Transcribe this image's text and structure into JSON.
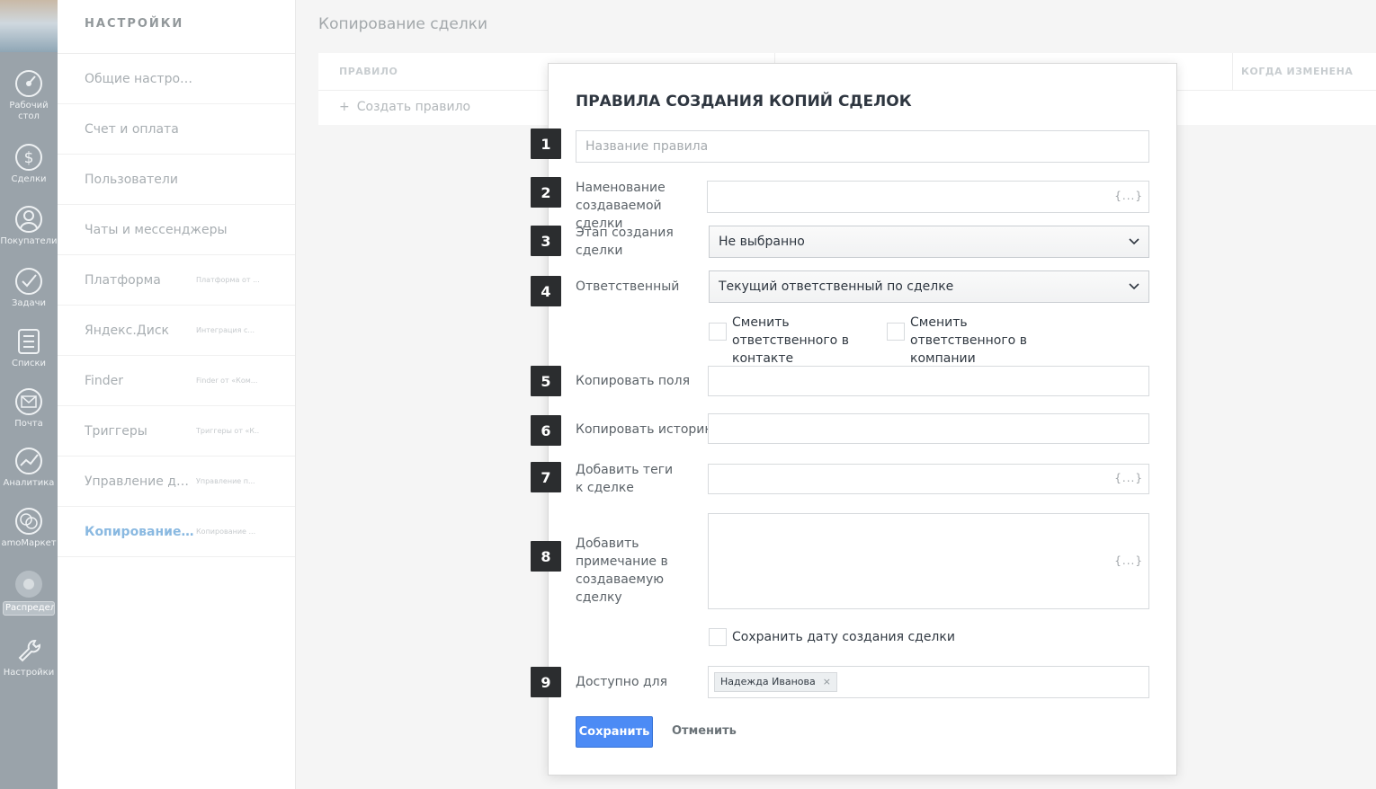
{
  "sidebar": {
    "items": [
      {
        "label": "Рабочий стол",
        "icon": "dashboard-icon"
      },
      {
        "label": "Сделки",
        "icon": "dollar-icon"
      },
      {
        "label": "Покупатели",
        "icon": "customers-icon"
      },
      {
        "label": "Задачи",
        "icon": "check-icon"
      },
      {
        "label": "Списки",
        "icon": "list-icon"
      },
      {
        "label": "Почта",
        "icon": "mail-icon"
      },
      {
        "label": "Аналитика",
        "icon": "analytics-icon"
      },
      {
        "label": "amoМаркет",
        "icon": "market-icon"
      },
      {
        "label": "Распредел",
        "icon": "distribution-icon"
      },
      {
        "label": "Настройки",
        "icon": "wrench-icon"
      }
    ]
  },
  "settings": {
    "title": "НАСТРОЙКИ",
    "items": [
      {
        "label": "Общие настройки",
        "sub": ""
      },
      {
        "label": "Счет и оплата",
        "sub": ""
      },
      {
        "label": "Пользователи",
        "sub": ""
      },
      {
        "label": "Чаты и мессенджеры",
        "sub": ""
      },
      {
        "label": "Платформа",
        "sub": "Платформа от ..."
      },
      {
        "label": "Яндекс.Диск",
        "sub": "Интеграция с..."
      },
      {
        "label": "Finder",
        "sub": "Finder от «Ком..."
      },
      {
        "label": "Триггеры",
        "sub": "Триггеры от «К..."
      },
      {
        "label": "Управление дан...",
        "sub": "Управление п..."
      },
      {
        "label": "Копирование сд...",
        "sub": "Копирование ..."
      }
    ]
  },
  "main": {
    "title": "Копирование сделки",
    "columns": {
      "rule": "ПРАВИЛО",
      "changed": "КОГДА ИЗМЕНЕНА"
    },
    "create_rule": "Создать правило"
  },
  "modal": {
    "title": "ПРАВИЛА СОЗДАНИЯ КОПИЙ СДЕЛОК",
    "badges": [
      "1",
      "2",
      "3",
      "4",
      "5",
      "6",
      "7",
      "8",
      "9"
    ],
    "rule_name_placeholder": "Название правила",
    "deal_name_label": "Наменование создаваемой сделки",
    "braces": "{...}",
    "stage_label": "Этап создания сделки",
    "stage_value": "Не выбранно",
    "responsible_label": "Ответственный",
    "responsible_value": "Текущий ответственный по сделке",
    "change_contact": "Сменить ответственного в контакте",
    "change_company": "Сменить ответственного в компании",
    "copy_fields_label": "Копировать поля",
    "copy_history_label": "Копировать историю",
    "add_tags_label": "Добавить теги к сделке",
    "add_note_label": "Добавить примечание в создаваемую сделку",
    "keep_date": "Сохранить дату создания сделки",
    "available_label": "Доступно для",
    "available_user": "Надежда Иванова",
    "tag_remove": "×",
    "save": "Сохранить",
    "cancel": "Отменить"
  },
  "colors": {
    "accent": "#4c8bf5",
    "badge": "#2b2d2f",
    "active_menu": "#8ab9e1"
  }
}
